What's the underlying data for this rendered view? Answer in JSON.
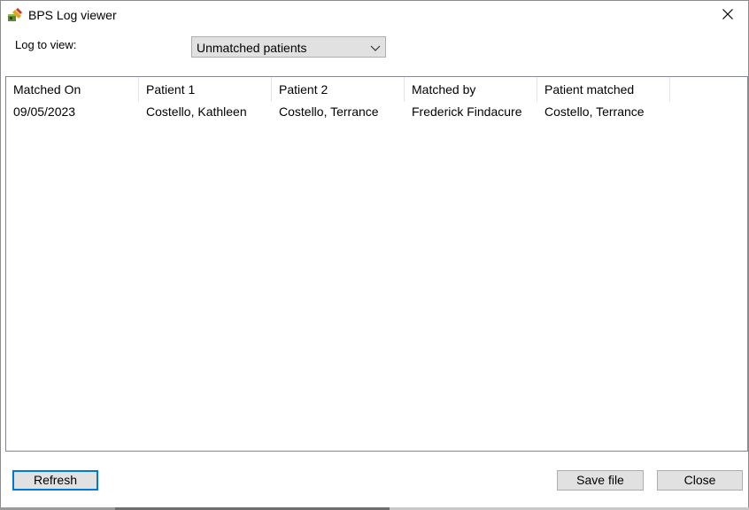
{
  "window": {
    "title": "BPS Log viewer",
    "app_icon": "bps-app-icon",
    "close_icon": "close-icon"
  },
  "controls": {
    "log_label": "Log to view:",
    "log_select_value": "Unmatched patients",
    "log_select_arrow_icon": "chevron-down-icon"
  },
  "table": {
    "columns": [
      "Matched On",
      "Patient 1",
      "Patient 2",
      "Matched by",
      "Patient matched"
    ],
    "rows": [
      [
        "09/05/2023",
        "Costello, Kathleen",
        "Costello, Terrance",
        "Frederick Findacure",
        "Costello, Terrance"
      ]
    ]
  },
  "buttons": {
    "refresh": "Refresh",
    "save_file": "Save file",
    "close": "Close"
  },
  "colors": {
    "default_button_border": "#0078d7",
    "button_face": "#e1e1e1"
  }
}
